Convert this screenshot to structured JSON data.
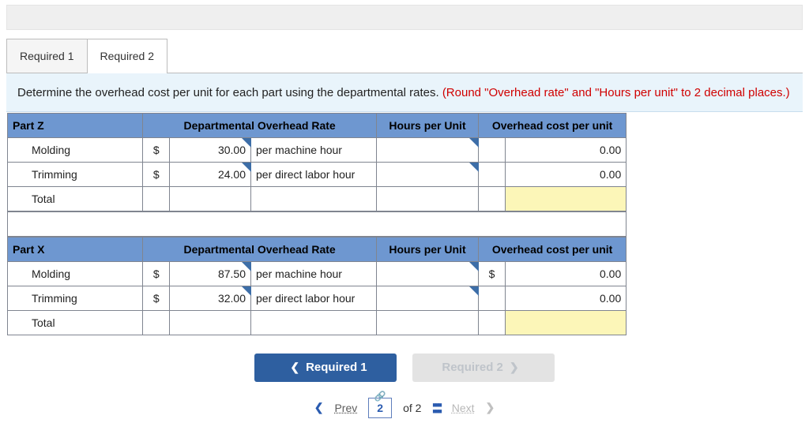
{
  "tabs": {
    "r1": "Required 1",
    "r2": "Required 2",
    "active": "r2"
  },
  "instruction": {
    "main": "Determine the overhead cost per unit for each part using the departmental rates. ",
    "note": "(Round \"Overhead rate\" and \"Hours per unit\" to 2 decimal places.)"
  },
  "headers": {
    "rate": "Departmental Overhead Rate",
    "hpu": "Hours per Unit",
    "cost": "Overhead cost per unit"
  },
  "labels": {
    "molding": "Molding",
    "trimming": "Trimming",
    "total": "Total",
    "per_mh": "per machine hour",
    "per_dlh": "per direct labor hour",
    "dollar": "$"
  },
  "partZ": {
    "title": "Part Z",
    "molding_rate": "30.00",
    "trimming_rate": "24.00",
    "molding_cost": "0.00",
    "trimming_cost": "0.00"
  },
  "partX": {
    "title": "Part X",
    "molding_rate": "87.50",
    "trimming_rate": "32.00",
    "molding_cost": "0.00",
    "trimming_cost": "0.00"
  },
  "nav": {
    "prev": "Required 1",
    "next": "Required 2"
  },
  "pager": {
    "prev": "Prev",
    "next": "Next",
    "current": "2",
    "of": "of 2"
  }
}
